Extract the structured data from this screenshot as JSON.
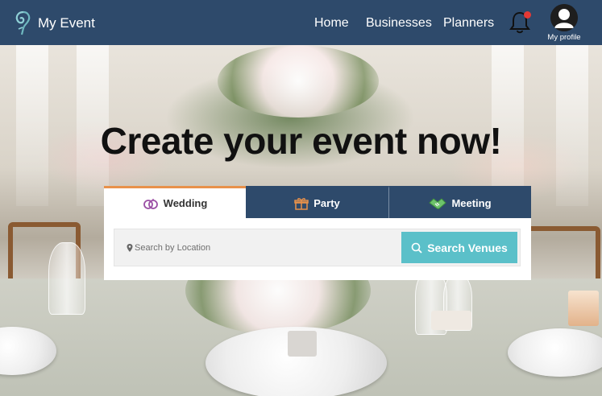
{
  "brand": {
    "name": "My Event"
  },
  "nav": {
    "home": "Home",
    "businesses": "Businesses",
    "planners": "Planners",
    "profile_label": "My profile"
  },
  "hero": {
    "headline": "Create your event now!"
  },
  "tabs": [
    {
      "label": "Wedding",
      "icon": "rings-icon",
      "active": true
    },
    {
      "label": "Party",
      "icon": "gift-icon",
      "active": false
    },
    {
      "label": "Meeting",
      "icon": "handshake-icon",
      "active": false
    }
  ],
  "search": {
    "placeholder": "Search by Location",
    "button_label": "Search Venues"
  },
  "colors": {
    "navbar": "#2e4a6b",
    "tab_accent": "#e8914b",
    "search_button": "#5bc0c9",
    "notification_dot": "#e53935"
  }
}
